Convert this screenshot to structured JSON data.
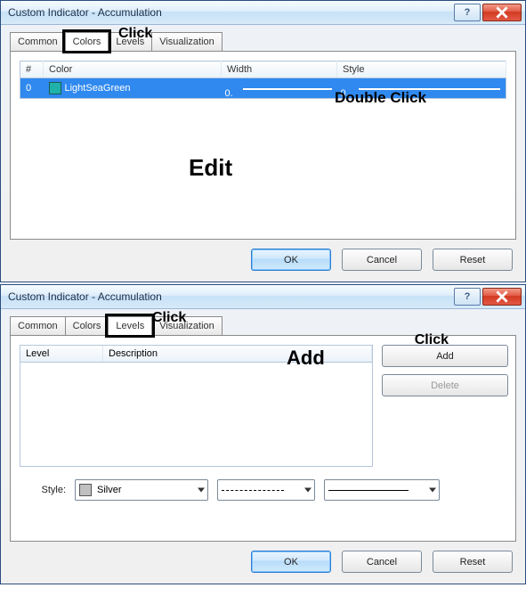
{
  "window1": {
    "title": "Custom Indicator - Accumulation",
    "tabs": [
      "Common",
      "Colors",
      "Levels",
      "Visualization"
    ],
    "active_tab": "Colors",
    "table": {
      "headers": [
        "#",
        "Color",
        "Width",
        "Style"
      ],
      "row": {
        "index": "0",
        "color_name": "LightSeaGreen",
        "color_hex": "#20b2aa",
        "width_value": "0.",
        "style_value": "0."
      }
    },
    "buttons": {
      "ok": "OK",
      "cancel": "Cancel",
      "reset": "Reset"
    },
    "annotations": {
      "click": "Click",
      "dblclick": "Double Click",
      "edit": "Edit"
    }
  },
  "window2": {
    "title": "Custom Indicator - Accumulation",
    "tabs": [
      "Common",
      "Colors",
      "Levels",
      "Visualization"
    ],
    "active_tab": "Levels",
    "list_headers": {
      "level": "Level",
      "description": "Description"
    },
    "side_buttons": {
      "add": "Add",
      "delete": "Delete"
    },
    "style_label": "Style:",
    "color_name": "Silver",
    "color_hex": "#c0c0c0",
    "buttons": {
      "ok": "OK",
      "cancel": "Cancel",
      "reset": "Reset"
    },
    "annotations": {
      "click_tab": "Click",
      "add_label": "Add",
      "click_add": "Click"
    }
  }
}
